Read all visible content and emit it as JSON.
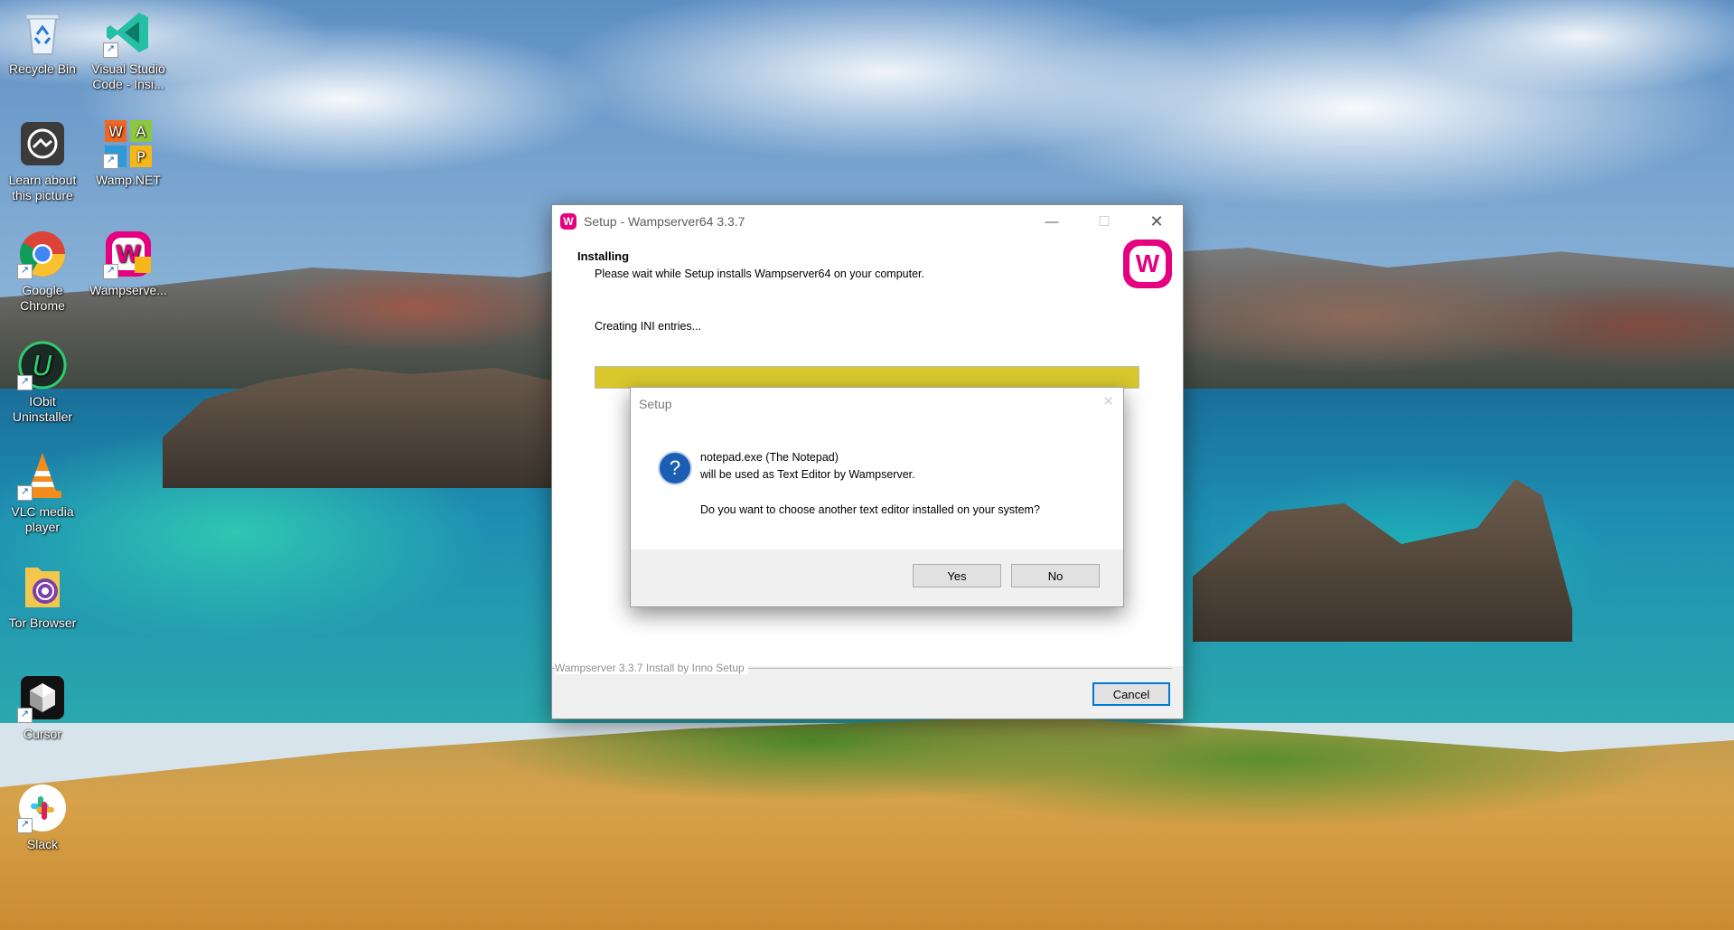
{
  "desktop": {
    "icons": [
      {
        "label": "Recycle Bin",
        "icon": "recycle-bin-icon"
      },
      {
        "label": "Visual Studio Code - Insi...",
        "icon": "vscode-insiders-icon"
      },
      {
        "label": "Learn about this picture",
        "icon": "learn-picture-icon"
      },
      {
        "label": "Wamp.NET",
        "icon": "wamp-net-icon"
      },
      {
        "label": "Google Chrome",
        "icon": "chrome-icon"
      },
      {
        "label": "Wampserve...",
        "icon": "wampserver-icon"
      },
      {
        "label": "IObit Uninstaller",
        "icon": "iobit-uninstaller-icon"
      },
      {
        "label": "VLC media player",
        "icon": "vlc-icon"
      },
      {
        "label": "Tor Browser",
        "icon": "tor-browser-icon"
      },
      {
        "label": "Cursor",
        "icon": "cursor-icon"
      },
      {
        "label": "Slack",
        "icon": "slack-icon"
      }
    ]
  },
  "setup_window": {
    "title": "Setup - Wampserver64 3.3.7",
    "app_icon": "W",
    "heading": "Installing",
    "subheading": "Please wait while Setup installs Wampserver64 on your computer.",
    "status": "Creating INI entries...",
    "progress": 1.0,
    "progress_color": "#d8c82c",
    "branding": "Wampserver 3.3.7 Install by Inno Setup",
    "cancel_label": "Cancel",
    "logo": "W"
  },
  "dialog": {
    "title": "Setup",
    "icon": "question-icon",
    "line1": "notepad.exe (The Notepad)",
    "line2": "will be used as Text Editor by Wampserver.",
    "question": "Do you want to choose another text editor installed on your system?",
    "yes_label": "Yes",
    "no_label": "No"
  }
}
